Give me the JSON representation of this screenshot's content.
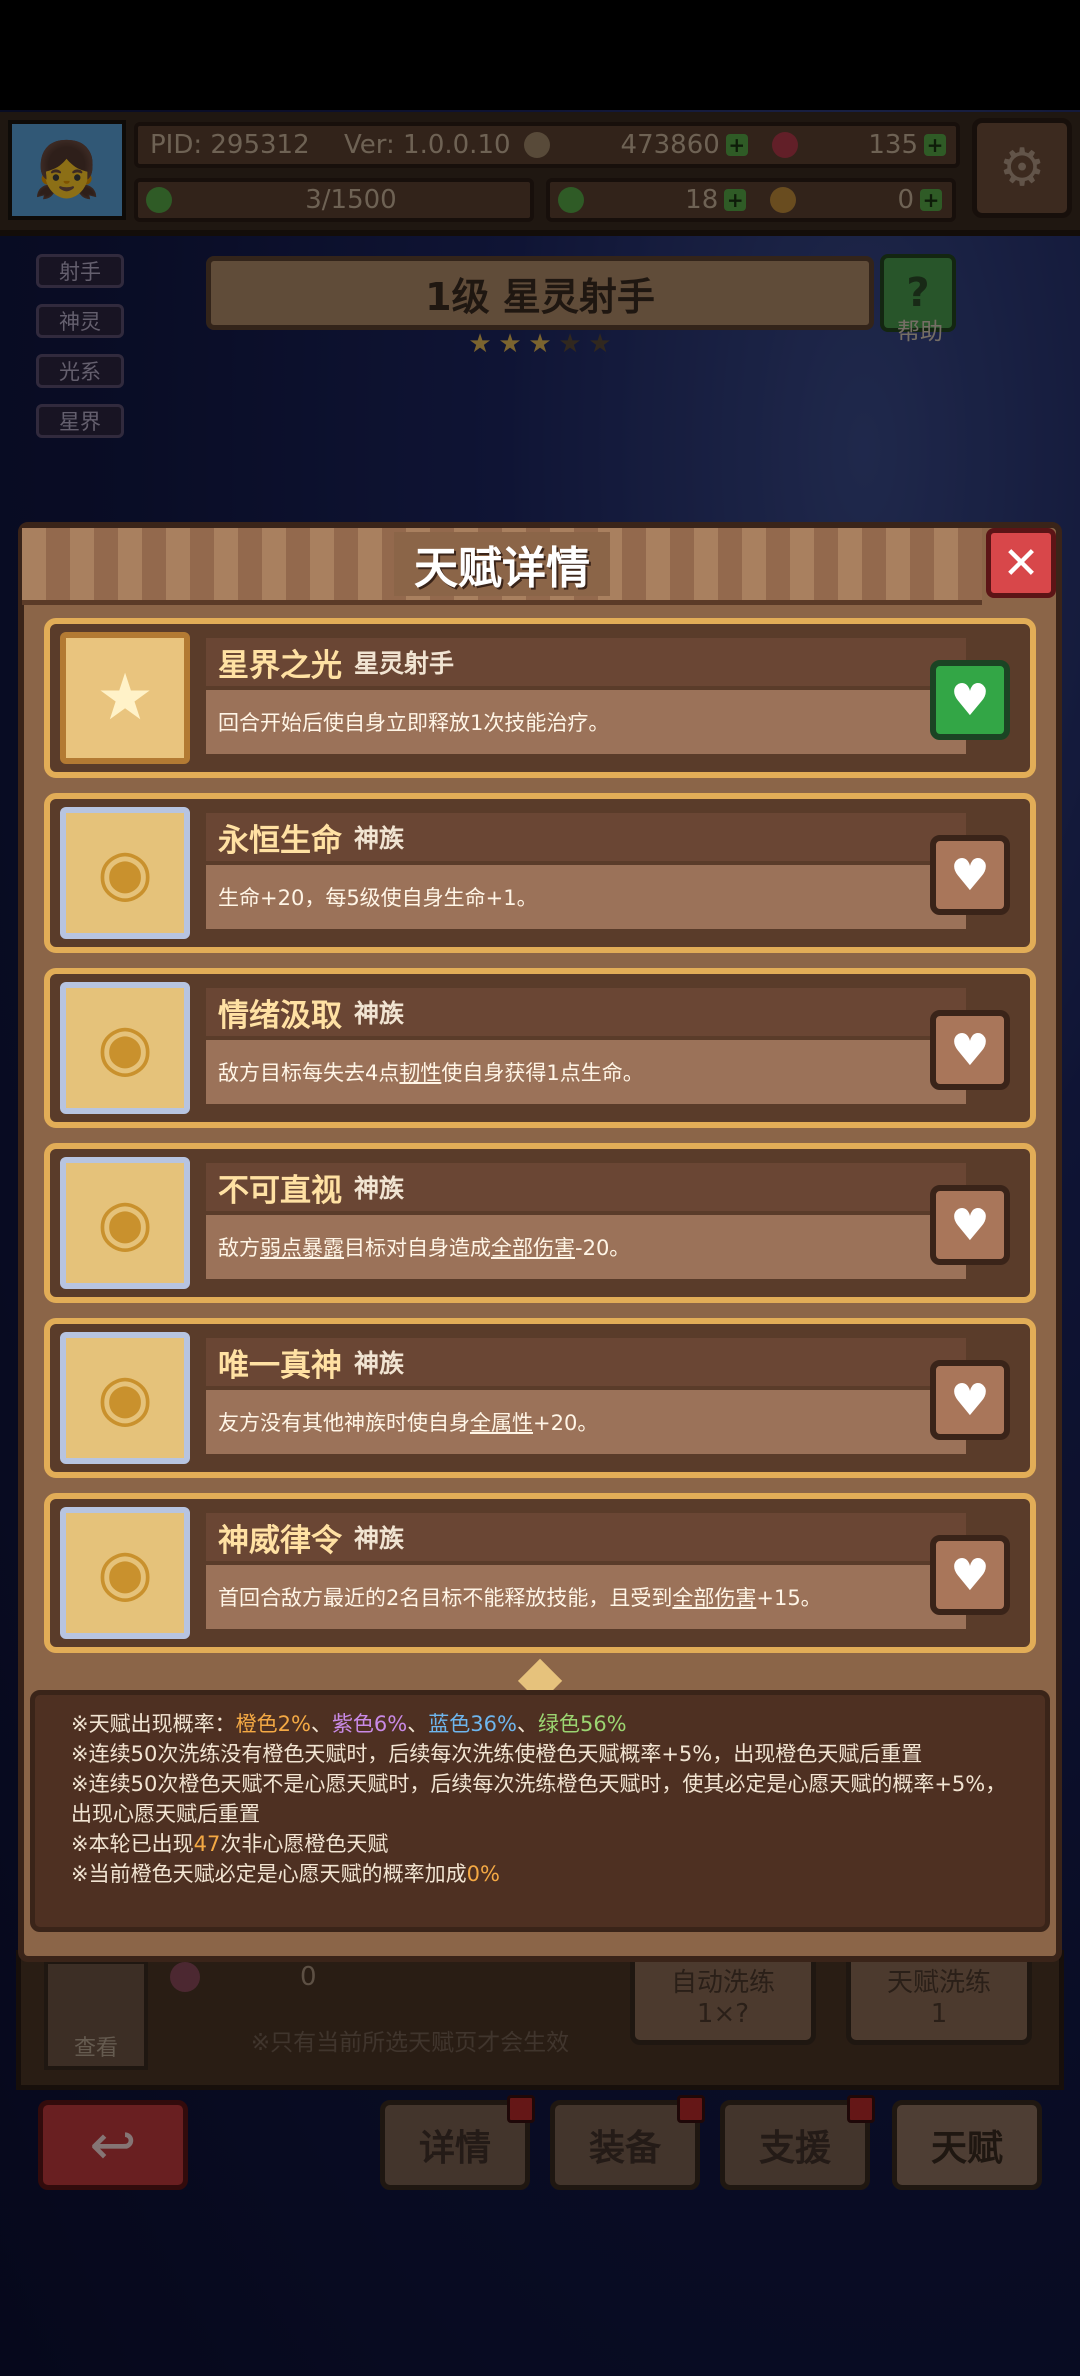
{
  "topbar": {
    "pid": "PID: 295312",
    "version": "Ver: 1.0.0.10",
    "gold": "473860",
    "gems": "135",
    "progress": "3/1500",
    "clover": "18",
    "keys": "0"
  },
  "tags": [
    "射手",
    "神灵",
    "光系",
    "星界"
  ],
  "hero": {
    "title": "1级  星灵射手",
    "stars_total": 5,
    "stars_filled": 3,
    "help_label": "帮助"
  },
  "modal": {
    "title": "天赋详情",
    "talents": [
      {
        "name": "星界之光",
        "type": "星灵射手",
        "desc": "回合开始后使自身立即释放1次技能治疗。",
        "wish": true,
        "icon": "star-icon"
      },
      {
        "name": "永恒生命",
        "type": "神族",
        "desc": "生命+20，每5级使自身生命+1。",
        "wish": false,
        "icon": "divine-emblem-icon"
      },
      {
        "name": "情绪汲取",
        "type": "神族",
        "desc_parts": [
          "敌方目标每失去4点",
          "韧性",
          "使自身获得1点生命。"
        ],
        "wish": false,
        "icon": "divine-emblem-icon"
      },
      {
        "name": "不可直视",
        "type": "神族",
        "desc_parts": [
          "敌方",
          "弱点暴露",
          "目标对自身造成",
          "全部伤害",
          "-20。"
        ],
        "wish": false,
        "icon": "divine-emblem-icon"
      },
      {
        "name": "唯一真神",
        "type": "神族",
        "desc_parts": [
          "友方没有其他神族时使自身",
          "全属性",
          "+20。"
        ],
        "wish": false,
        "icon": "divine-emblem-icon"
      },
      {
        "name": "神威律令",
        "type": "神族",
        "desc_parts": [
          "首回合敌方最近的2名目标不能释放技能，且受到",
          "全部伤害",
          "+15。"
        ],
        "wish": false,
        "icon": "divine-emblem-icon"
      }
    ],
    "info": {
      "line1_prefix": "※天赋出现概率：",
      "orange": "橙色2%",
      "sep": "、",
      "purple": "紫色6%",
      "blue": "蓝色36%",
      "green": "绿色56%",
      "line2": "※连续50次洗练没有橙色天赋时，后续每次洗练使橙色天赋概率+5%，出现橙色天赋后重置",
      "line3": "※连续50次橙色天赋不是心愿天赋时，后续每次洗练橙色天赋时，使其必定是心愿天赋的概率+5%，出现心愿天赋后重置",
      "line4_prefix": "※本轮已出现",
      "line4_count": "47",
      "line4_suffix": "次非心愿橙色天赋",
      "line5_prefix": "※当前橙色天赋必定是心愿天赋的概率加成",
      "line5_value": "0%"
    }
  },
  "bottom": {
    "look_label": "查看",
    "count": "0",
    "hint": "※只有当前所选天赋页才会生效",
    "auto_label": "自动洗练",
    "auto_cost": "1×?",
    "refine_label": "天赋洗练",
    "refine_cost": "1",
    "nav": [
      "详情",
      "装备",
      "支援",
      "天赋"
    ]
  },
  "colors": {
    "orange": "#f4a944",
    "purple": "#c98ae6",
    "blue": "#6eb6ee",
    "green": "#9bd571",
    "wish_on": "#33a646"
  }
}
